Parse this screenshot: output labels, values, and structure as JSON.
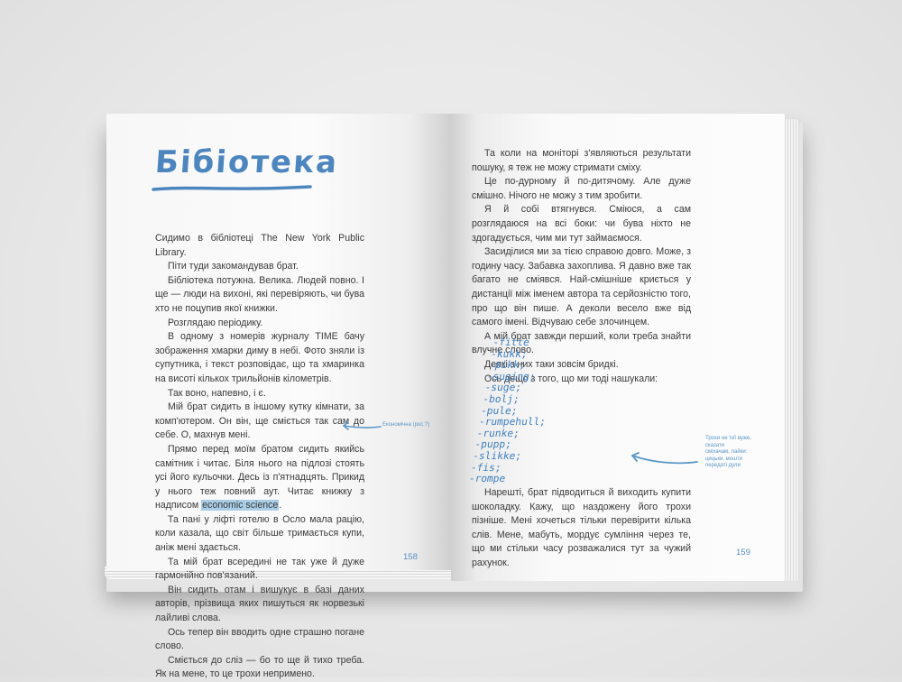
{
  "title": "Бібіотека",
  "left_paragraphs": [
    {
      "text": "Сидимо в бібліотеці The New York Public Library.",
      "indent": false
    },
    {
      "text": "Піти туди закомандував брат.",
      "indent": true
    },
    {
      "text": "Бібліотека потужна. Велика. Людей повно. І ще — люди на вихоні, які перевіряють, чи бува хто не поцупив якої книжки.",
      "indent": true
    },
    {
      "text": "Розглядаю періодику.",
      "indent": true
    },
    {
      "text": "В одному з номерів журналу TIME бачу зображення хмарки диму в небі. Фото зняли із супутника, і текст розповідає, що та хмаринка на висоті кількох трильйонів кілометрів.",
      "indent": true
    },
    {
      "text": "Так воно, напевно, і є.",
      "indent": true
    },
    {
      "text": "Мій брат сидить в іншому кутку кімнати, за комп'ютером. Он він, ще сміється так сам до себе. О, махнув мені.",
      "indent": true
    },
    {
      "text": "Прямо перед моїм братом сидить якийсь самітник і читає. Біля нього на підлозі стоять усі його кульочки. Десь із п'ятнадцять. Прикид у нього теж повний аут. Читає книжку з надписом",
      "indent": true,
      "highlight": "economic science",
      "after": "."
    },
    {
      "text": "Та пані у ліфті готелю в Осло мала рацію, коли казала, що світ більше тримається купи, аніж мені здається.",
      "indent": true
    },
    {
      "text": "Та мій брат всередині не так уже й дуже гармонійно пов'язаний.",
      "indent": true
    },
    {
      "text": "Він сидить отам і вишукує в базі даних авторів, прізвища яких пишуться як норвезькі лайливі слова.",
      "indent": true
    },
    {
      "text": "Ось тепер він вводить одне страшно погане слово.",
      "indent": true
    },
    {
      "text": "Сміється до сліз — бо то ще й тихо треба. Як на мене, то це трохи непримено.",
      "indent": true
    }
  ],
  "left_margin_note": "Економічна (рос.?)",
  "left_page_number": "158",
  "right_paragraphs_top": [
    {
      "text": "Та коли на моніторі з'являються результати пошуку, я теж не можу стримати сміху.",
      "indent": true
    },
    {
      "text": "Це по-дурному й по-дитячому. Але дуже смішно. Нічого не можу з тим зробити.",
      "indent": true
    },
    {
      "text": "Я й собі втягнувся. Сміюся, а сам розглядаюся на всі боки: чи бува ніхто не здогадується, чим ми тут займаємося.",
      "indent": true
    },
    {
      "text": "Засиділися ми за тією справою довго. Може, з годину часу. Забавка захоплива. Я давно вже так багато не сміявся. Най-смішніше криється у дистанції між іменем автора та серйозністю того, про що він пише. А деколи весело вже від самого імені. Відчуваю себе злочинцем.",
      "indent": true
    },
    {
      "text": "А мій брат завжди перший, коли треба знайти влучне слово.",
      "indent": true
    },
    {
      "text": "Деякі з них таки зовсім бридкі.",
      "indent": true
    },
    {
      "text": "Ось дещо з того, що ми тоді нашукали:",
      "indent": true
    }
  ],
  "hand_list": [
    "-fitte",
    "-kukk;",
    "-pikk;",
    "-suging;",
    "-suge;",
    "-bolj;",
    "-pule;",
    "-rumpehull;",
    "-runke;",
    "-pupp;",
    "-slikke;",
    "-fis;",
    "-rompe"
  ],
  "right_margin_note": [
    "Трохи не тиї вуже, сказати",
    "сміхачам, лайки:",
    "цицьки, мошти",
    "передаті дули"
  ],
  "right_paragraphs_bottom": [
    {
      "text": "Нарешті, брат підводиться й виходить купити шоколадку. Кажу, що наздожену його трохи пізніше. Мені хочеться тільки перевірити кілька слів. Мене, мабуть, мордує сумління через те, що ми стільки часу розважалися тут за чужий рахунок.",
      "indent": true
    }
  ],
  "right_page_number": "159",
  "colors": {
    "accent_blue": "#4d86bf",
    "highlight": "#a9cde6",
    "text": "#3a3a3a",
    "margin_note": "#5b97c9"
  }
}
